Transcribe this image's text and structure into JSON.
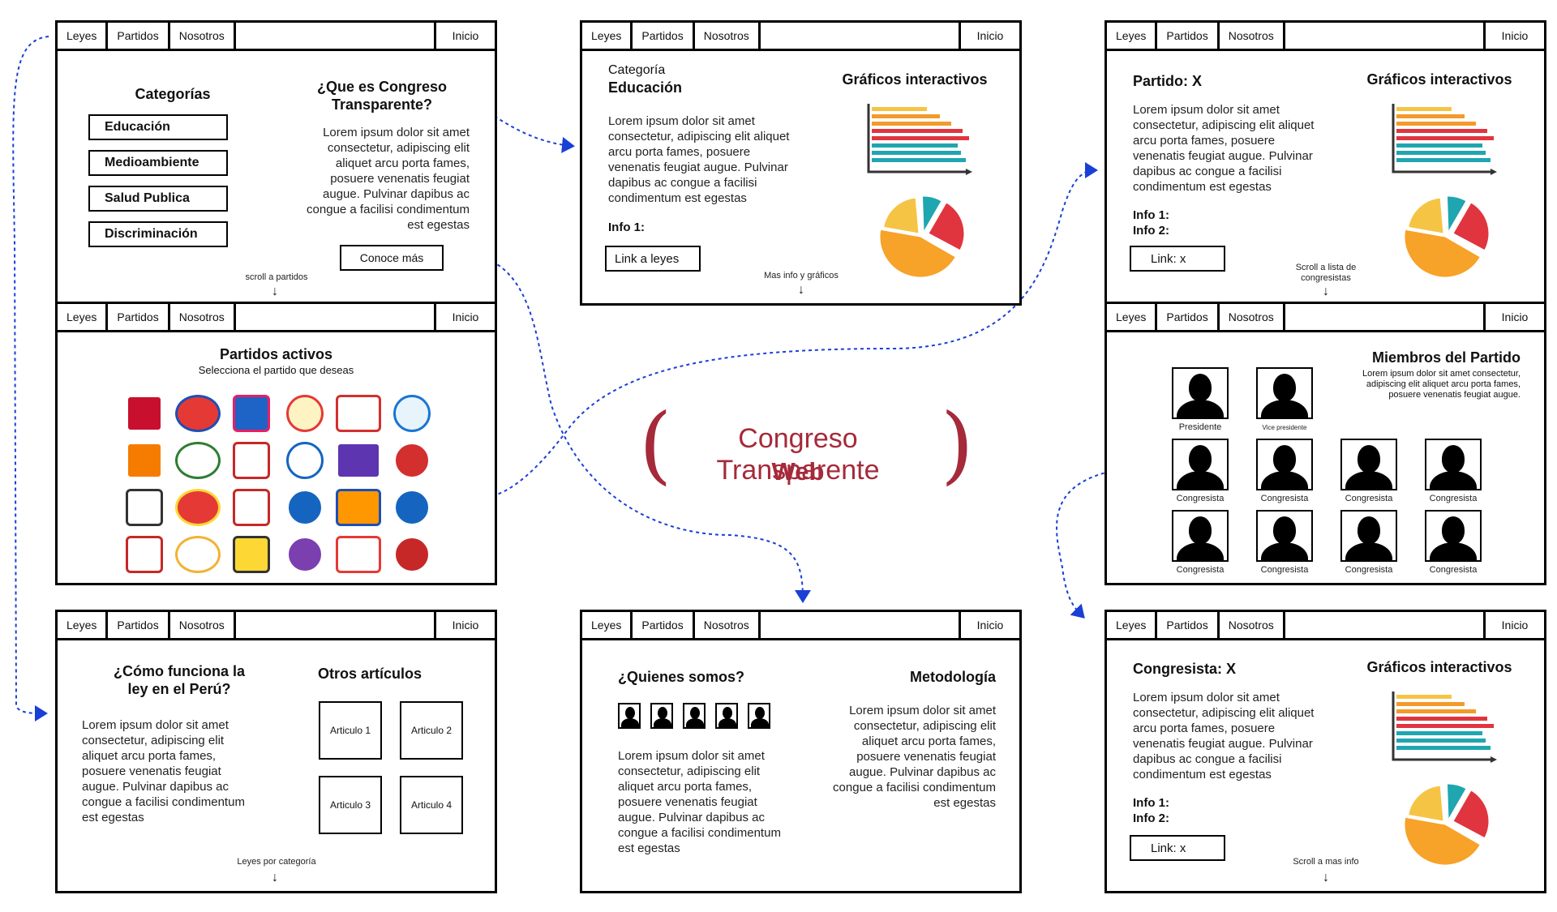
{
  "nav": {
    "leyes": "Leyes",
    "partidos": "Partidos",
    "nosotros": "Nosotros",
    "inicio": "Inicio"
  },
  "brand": {
    "title": "Congreso Transparente",
    "subtitle": "Web",
    "color": "#a52a3a"
  },
  "lorem": "Lorem ipsum dolor sit amet consectetur, adipiscing elit aliquet arcu porta fames, posuere venenatis feugiat augue. Pulvinar dapibus ac congue a facilisi condimentum est egestas",
  "lorem_short": "Lorem ipsum dolor sit amet consectetur, adipiscing elit aliquet arcu porta fames, posuere venenatis feugiat augue.",
  "home": {
    "categorias_title": "Categorías",
    "categories": [
      "Educación",
      "Medioambiente",
      "Salud Publica",
      "Discriminación"
    ],
    "que_es_title": "¿Que es Congreso Transparente?",
    "conoce_button": "Conoce más",
    "scroll_hint": "scroll a partidos"
  },
  "partidos": {
    "title": "Partidos activos",
    "subtitle": "Selecciona el partido que deseas"
  },
  "como": {
    "title": "¿Cómo funciona la ley en el Perú?",
    "otros_title": "Otros artículos",
    "articles": [
      "Articulo 1",
      "Articulo 2",
      "Articulo 3",
      "Articulo 4"
    ],
    "scroll_hint": "Leyes por categoría"
  },
  "categoria": {
    "label": "Categoría",
    "name": "Educación",
    "graficos_title": "Gráficos interactivos",
    "info1": "Info 1:",
    "link_button": "Link a leyes",
    "scroll_hint": "Mas info y gráficos"
  },
  "nosotros_page": {
    "quienes_title": "¿Quienes somos?",
    "metodologia_title": "Metodología"
  },
  "partido": {
    "title": "Partido: X",
    "graficos_title": "Gráficos interactivos",
    "info1": "Info 1:",
    "info2": "Info 2:",
    "link_button": "Link: x",
    "scroll_hint": "Scroll a lista de congresistas"
  },
  "miembros": {
    "title": "Miembros del Partido",
    "presidente": "Presidente",
    "vice": "Vice presidente",
    "congresista": "Congresista"
  },
  "congresista": {
    "title": "Congresista: X",
    "graficos_title": "Gráficos interactivos",
    "info1": "Info 1:",
    "info2": "Info 2:",
    "link_button": "Link: x",
    "scroll_hint": "Scroll a mas info"
  },
  "colors": {
    "flow_arrow": "#1a3fd6",
    "bar_yellow": "#f6c445",
    "bar_orange": "#f39a2a",
    "bar_red": "#e0353f",
    "bar_teal": "#1fa6b0",
    "pie_orange": "#f7a228"
  }
}
